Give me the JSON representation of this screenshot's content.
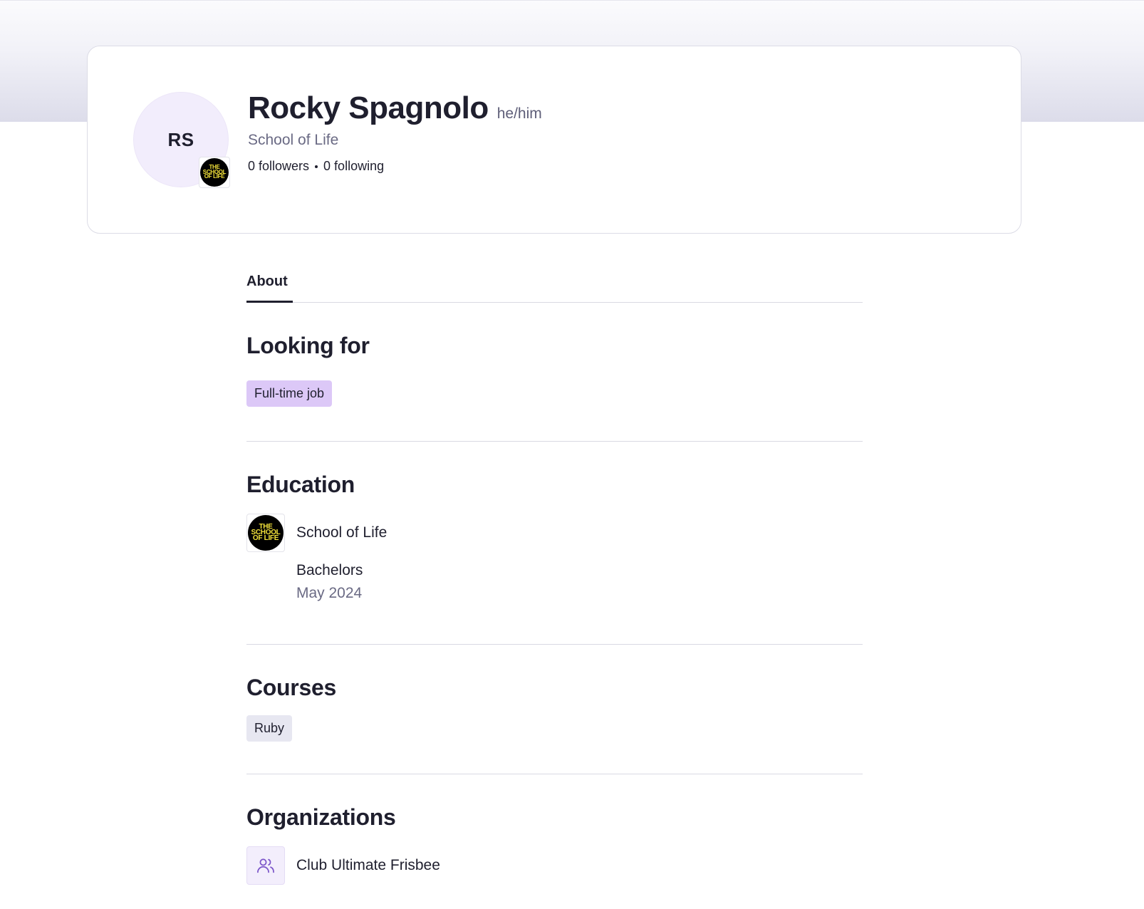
{
  "profile": {
    "initials": "RS",
    "name": "Rocky Spagnolo",
    "pronouns": "he/him",
    "school": "School of Life",
    "followers": "0 followers",
    "following": "0 following"
  },
  "school_logo": {
    "lines": [
      "THE",
      "SCHOOL",
      "OF LIFE"
    ],
    "background": "#000000",
    "text_color": "#f2e13a"
  },
  "tabs": [
    {
      "label": "About",
      "active": true
    }
  ],
  "sections": {
    "looking_for": {
      "title": "Looking for",
      "tags": [
        "Full-time job"
      ]
    },
    "education": {
      "title": "Education",
      "school": "School of Life",
      "degree": "Bachelors",
      "date": "May 2024"
    },
    "courses": {
      "title": "Courses",
      "tags": [
        "Ruby"
      ]
    },
    "organizations": {
      "title": "Organizations",
      "items": [
        {
          "name": "Club Ultimate Frisbee",
          "icon": "people-icon"
        }
      ]
    }
  },
  "colors": {
    "accent_purple": "#dcc8f7",
    "tag_gray": "#e7e7f1",
    "text_primary": "#1f1f2e",
    "text_muted": "#6a6a84",
    "icon_purple": "#7b55c9"
  }
}
